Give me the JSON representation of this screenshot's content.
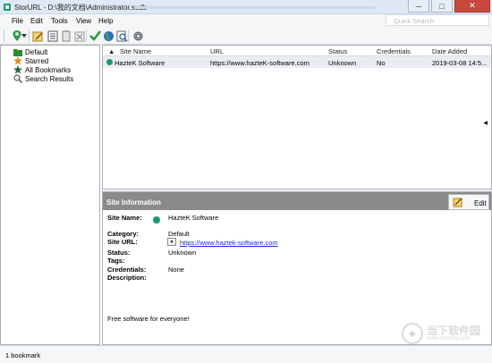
{
  "window": {
    "title": "StorURL - D:\\我的文档\\Administrator.sudb",
    "minimize": "─",
    "maximize": "□",
    "close": "✕"
  },
  "menu": {
    "items": [
      "File",
      "Edit",
      "Tools",
      "View",
      "Help"
    ],
    "quick_search_placeholder": "Quick Search"
  },
  "toolbar": {
    "icons": [
      "add-bookmark-icon",
      "dropdown-arrow-icon",
      "edit-icon",
      "notes-icon",
      "copy-icon",
      "delete-icon",
      "check-icon",
      "globe-icon",
      "find-icon",
      "settings-icon"
    ]
  },
  "sidebar": {
    "items": [
      {
        "label": "Default",
        "icon": "folder-icon",
        "color": "#2e8b2e"
      },
      {
        "label": "Starred",
        "icon": "star-icon",
        "color": "#e08a1e"
      },
      {
        "label": "All Bookmarks",
        "icon": "all-bookmarks-icon",
        "color": "#1b6d3a"
      },
      {
        "label": "Search Results",
        "icon": "search-results-icon",
        "color": "#555555"
      }
    ]
  },
  "grid": {
    "columns": [
      "Site Name",
      "URL",
      "Status",
      "Credentials",
      "Date Added"
    ],
    "rows": [
      {
        "site_name": "HazteK Software",
        "url": "https://www.hazteK-software.com",
        "status": "Unknown",
        "credentials": "No",
        "date_added": "2019-03-08 14:5..."
      }
    ]
  },
  "info": {
    "header": "Site Information",
    "edit_label": "Edit",
    "fields": {
      "site_name_label": "Site Name:",
      "site_name": "HazteK Software",
      "category_label": "Category:",
      "category": "Default",
      "site_url_label": "Site URL:",
      "site_url": "https://www.haztek-software.com",
      "status_label": "Status:",
      "status": "Unknown",
      "tags_label": "Tags:",
      "credentials_label": "Credentials:",
      "credentials": "None",
      "description_label": "Description:"
    },
    "description": "Free software for everyone!"
  },
  "watermark": {
    "text_cn": "当下软件园",
    "text_en": "www.downxia.com"
  },
  "status_bar": {
    "text": "1 bookmark"
  },
  "colors": {
    "status_dot": "#1a9a6c",
    "info_header": "#8a8a8a",
    "link": "#1a2ad0"
  }
}
